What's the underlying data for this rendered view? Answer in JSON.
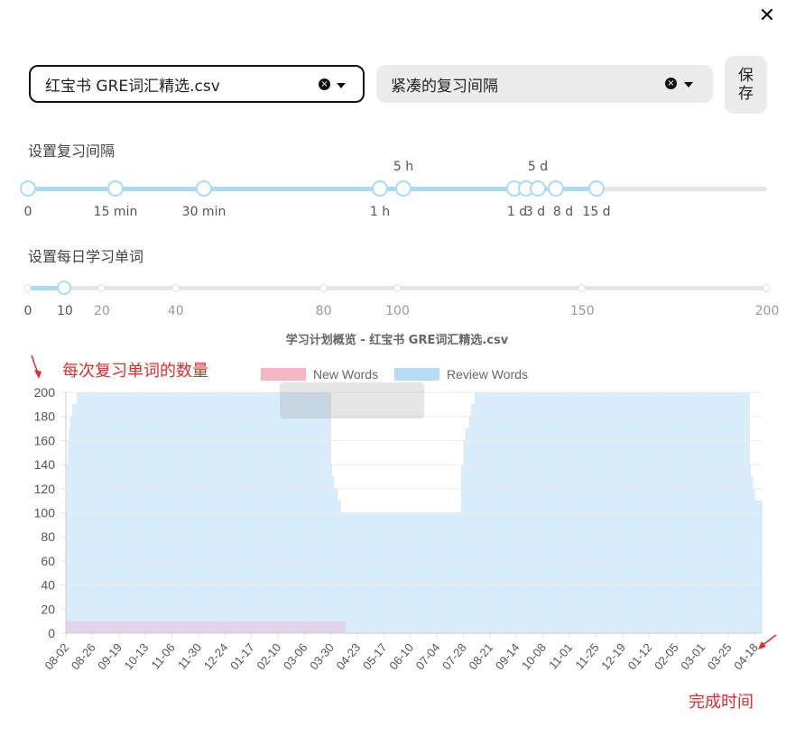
{
  "dialog": {
    "close_icon": "✕"
  },
  "word_file_select": {
    "value": "红宝书 GRE词汇精选.csv"
  },
  "interval_preset_select": {
    "value": "紧凑的复习间隔"
  },
  "save_button": {
    "label_line1": "保",
    "label_line2": "存"
  },
  "review_interval": {
    "label": "设置复习间隔",
    "bottom_ticks": [
      {
        "label": "0"
      },
      {
        "label": "15 min"
      },
      {
        "label": "30 min"
      },
      {
        "label": "1 h"
      },
      {
        "label": "1 d"
      },
      {
        "label": "3 d"
      },
      {
        "label": "8 d"
      },
      {
        "label": "15 d"
      }
    ],
    "top_ticks": [
      {
        "label": "5 h"
      },
      {
        "label": "5 d"
      }
    ]
  },
  "daily_words": {
    "label": "设置每日学习单词",
    "ticks": [
      "0",
      "10",
      "20",
      "40",
      "80",
      "100",
      "150",
      "200"
    ],
    "selected_value": 10,
    "max_value": 200
  },
  "annotations": {
    "count_label": "每次复习单词的数量",
    "time_label": "完成时间"
  },
  "chart_data": {
    "type": "area",
    "title": "学习计划概览 - 红宝书 GRE词汇精选.csv",
    "legend": {
      "placement": "top-center",
      "entries": [
        "New Words",
        "Review Words"
      ]
    },
    "series": [
      {
        "name": "New Words",
        "color": "#f4a9b8",
        "description_values": "10 per day from 08-02 until 04-12, then 0"
      },
      {
        "name": "Review Words",
        "color": "#a9d6f5"
      }
    ],
    "ylim": [
      0,
      200
    ],
    "yticks": [
      0,
      20,
      40,
      60,
      80,
      100,
      120,
      140,
      160,
      180,
      200
    ],
    "x_ticks": [
      "08-02",
      "08-26",
      "09-19",
      "10-13",
      "11-06",
      "11-30",
      "12-24",
      "01-17",
      "02-10",
      "03-06",
      "03-30",
      "04-23",
      "05-17",
      "06-10",
      "07-04",
      "07-28",
      "08-21",
      "09-14",
      "10-08",
      "11-01",
      "11-25",
      "12-19",
      "01-12",
      "02-05",
      "03-01",
      "03-25",
      "04-18"
    ],
    "x_range": [
      "08-02",
      "04-24"
    ],
    "grid": true,
    "review_profile": [
      {
        "x": "08-02",
        "y": 100
      },
      {
        "x": "08-03",
        "y": 140
      },
      {
        "x": "08-04",
        "y": 160
      },
      {
        "x": "08-05",
        "y": 170
      },
      {
        "x": "08-06",
        "y": 180
      },
      {
        "x": "08-08",
        "y": 190
      },
      {
        "x": "08-12",
        "y": 200
      },
      {
        "x": "03-29",
        "y": 200
      },
      {
        "x": "03-30",
        "y": 140
      },
      {
        "x": "03-31",
        "y": 130
      },
      {
        "x": "04-02",
        "y": 120
      },
      {
        "x": "04-05",
        "y": 110
      },
      {
        "x": "04-08",
        "y": 100
      },
      {
        "x": "07-25",
        "y": 100
      },
      {
        "x": "07-26",
        "y": 140
      },
      {
        "x": "07-28",
        "y": 160
      },
      {
        "x": "07-30",
        "y": 170
      },
      {
        "x": "08-02",
        "y": 180
      },
      {
        "x": "08-04",
        "y": 190
      },
      {
        "x": "08-07",
        "y": 200
      },
      {
        "x": "04-12",
        "y": 200
      },
      {
        "x": "04-13",
        "y": 140
      },
      {
        "x": "04-14",
        "y": 130
      },
      {
        "x": "04-16",
        "y": 120
      },
      {
        "x": "04-18",
        "y": 110
      },
      {
        "x": "04-24",
        "y": 110
      }
    ]
  }
}
